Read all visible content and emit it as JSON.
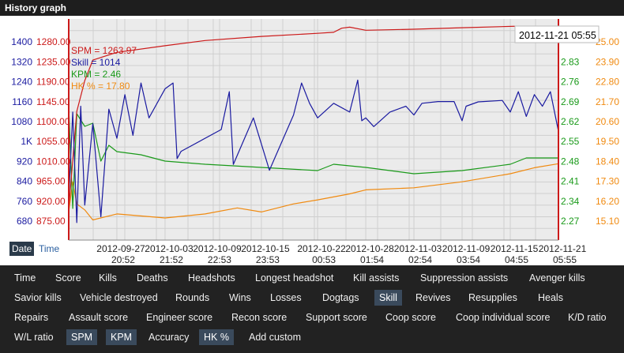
{
  "header": {
    "title": "History graph"
  },
  "tooltip": {
    "text": "2012-11-21 05:55"
  },
  "x_mode": {
    "date_label": "Date",
    "time_label": "Time",
    "selected": "Date"
  },
  "colors": {
    "skill": "#1a1aa0",
    "spm": "#cc1a1a",
    "kpm": "#1a9a1a",
    "hk": "#f08a10",
    "background": "#ebebeb",
    "grid": "#cfcfcf",
    "panel": "#222222",
    "selected": "#3a4a5c"
  },
  "chart_data": {
    "type": "line",
    "x_ticks": [
      {
        "date": "2012-09-27",
        "time": "20:52"
      },
      {
        "date": "2012-10-03",
        "time": "21:52"
      },
      {
        "date": "2012-10-09",
        "time": "22:53"
      },
      {
        "date": "2012-10-15",
        "time": "23:53"
      },
      {
        "date": "2012-10-22",
        "time": "00:53"
      },
      {
        "date": "2012-10-28",
        "time": "01:54"
      },
      {
        "date": "2012-11-03",
        "time": "02:54"
      },
      {
        "date": "2012-11-09",
        "time": "03:54"
      },
      {
        "date": "2012-11-15",
        "time": "04:55"
      },
      {
        "date": "2012-11-21",
        "time": "05:55"
      }
    ],
    "x_range": [
      "2012-09-21",
      "2012-11-21"
    ],
    "grid": true,
    "axes": [
      {
        "series": "Skill",
        "side": "left",
        "ticks": [
          "680",
          "760",
          "840",
          "920",
          "1K",
          "1080",
          "1160",
          "1240",
          "1320",
          "1400"
        ],
        "range": [
          640,
          1400
        ]
      },
      {
        "series": "SPM",
        "side": "left",
        "ticks": [
          "875.00",
          "920.00",
          "965.00",
          "1010.00",
          "1055.00",
          "1100.00",
          "1145.00",
          "1190.00",
          "1235.00",
          "1280.00"
        ],
        "range": [
          850,
          1280
        ]
      },
      {
        "series": "KPM",
        "side": "right",
        "ticks": [
          "2.27",
          "2.34",
          "2.41",
          "2.48",
          "2.55",
          "2.62",
          "2.69",
          "2.76",
          "2.83"
        ],
        "range": [
          2.2,
          2.9
        ]
      },
      {
        "series": "HK %",
        "side": "right",
        "ticks": [
          "15.10",
          "16.20",
          "17.30",
          "18.40",
          "19.50",
          "20.60",
          "21.70",
          "22.80",
          "23.90",
          "25.00"
        ],
        "range": [
          14.0,
          25.0
        ]
      }
    ],
    "legend": [
      {
        "label": "SPM = 1263.97"
      },
      {
        "label": "Skill = 1014"
      },
      {
        "label": "KPM = 2.46"
      },
      {
        "label": "HK % = 17.80"
      }
    ],
    "series": [
      {
        "name": "SPM",
        "axis": 1,
        "values": [
          [
            "2012-09-21",
            910
          ],
          [
            "2012-09-22",
            1100
          ],
          [
            "2012-09-23",
            1160
          ],
          [
            "2012-09-24",
            1200
          ],
          [
            "2012-09-27",
            1215
          ],
          [
            "2012-10-03",
            1228
          ],
          [
            "2012-10-08",
            1238
          ],
          [
            "2012-10-15",
            1246
          ],
          [
            "2012-10-22",
            1252
          ],
          [
            "2012-10-24",
            1254
          ],
          [
            "2012-10-25",
            1262
          ],
          [
            "2012-10-26",
            1264
          ],
          [
            "2012-10-28",
            1258
          ],
          [
            "2012-11-03",
            1260
          ],
          [
            "2012-11-09",
            1263
          ],
          [
            "2012-11-16",
            1266
          ],
          [
            "2012-11-17",
            1262
          ],
          [
            "2012-11-21",
            1264
          ]
        ]
      },
      {
        "name": "Skill",
        "axis": 0,
        "values": [
          [
            "2012-09-21",
            780
          ],
          [
            "2012-09-21 12:00",
            1080
          ],
          [
            "2012-09-22",
            700
          ],
          [
            "2012-09-22 12:00",
            1100
          ],
          [
            "2012-09-23",
            760
          ],
          [
            "2012-09-24",
            1040
          ],
          [
            "2012-09-25",
            720
          ],
          [
            "2012-09-26",
            1090
          ],
          [
            "2012-09-27",
            990
          ],
          [
            "2012-09-28",
            1140
          ],
          [
            "2012-09-29",
            1000
          ],
          [
            "2012-09-30",
            1180
          ],
          [
            "2012-10-01",
            1060
          ],
          [
            "2012-10-03",
            1160
          ],
          [
            "2012-10-04",
            1180
          ],
          [
            "2012-10-04 12:00",
            920
          ],
          [
            "2012-10-05",
            945
          ],
          [
            "2012-10-10",
            1020
          ],
          [
            "2012-10-11",
            1150
          ],
          [
            "2012-10-11 12:00",
            900
          ],
          [
            "2012-10-14",
            1060
          ],
          [
            "2012-10-16",
            880
          ],
          [
            "2012-10-19",
            1070
          ],
          [
            "2012-10-20",
            1180
          ],
          [
            "2012-10-21",
            1110
          ],
          [
            "2012-10-22",
            1060
          ],
          [
            "2012-10-24",
            1110
          ],
          [
            "2012-10-26",
            1080
          ],
          [
            "2012-10-27",
            1190
          ],
          [
            "2012-10-27 12:00",
            1050
          ],
          [
            "2012-10-28",
            1060
          ],
          [
            "2012-10-29",
            1030
          ],
          [
            "2012-10-31",
            1080
          ],
          [
            "2012-11-02",
            1100
          ],
          [
            "2012-11-03",
            1070
          ],
          [
            "2012-11-04",
            1110
          ],
          [
            "2012-11-06",
            1116
          ],
          [
            "2012-11-08",
            1116
          ],
          [
            "2012-11-09",
            1050
          ],
          [
            "2012-11-09 12:00",
            1100
          ],
          [
            "2012-11-11",
            1115
          ],
          [
            "2012-11-14",
            1120
          ],
          [
            "2012-11-15",
            1080
          ],
          [
            "2012-11-16",
            1150
          ],
          [
            "2012-11-17",
            1065
          ],
          [
            "2012-11-18",
            1140
          ],
          [
            "2012-11-19",
            1100
          ],
          [
            "2012-11-20",
            1150
          ],
          [
            "2012-11-21",
            1014
          ]
        ]
      },
      {
        "name": "KPM",
        "axis": 2,
        "values": [
          [
            "2012-09-21",
            2.62
          ],
          [
            "2012-09-21 12:00",
            2.3
          ],
          [
            "2012-09-22",
            2.6
          ],
          [
            "2012-09-23",
            2.56
          ],
          [
            "2012-09-24",
            2.57
          ],
          [
            "2012-09-25",
            2.45
          ],
          [
            "2012-09-26",
            2.5
          ],
          [
            "2012-09-27",
            2.48
          ],
          [
            "2012-09-30",
            2.47
          ],
          [
            "2012-10-03",
            2.45
          ],
          [
            "2012-10-08",
            2.44
          ],
          [
            "2012-10-15",
            2.43
          ],
          [
            "2012-10-22",
            2.42
          ],
          [
            "2012-10-24",
            2.44
          ],
          [
            "2012-10-28",
            2.43
          ],
          [
            "2012-11-03",
            2.41
          ],
          [
            "2012-11-09",
            2.42
          ],
          [
            "2012-11-15",
            2.44
          ],
          [
            "2012-11-17",
            2.46
          ],
          [
            "2012-11-21",
            2.46
          ]
        ]
      },
      {
        "name": "HK %",
        "axis": 3,
        "values": [
          [
            "2012-09-21",
            15.4
          ],
          [
            "2012-09-21 12:00",
            16.9
          ],
          [
            "2012-09-22",
            15.8
          ],
          [
            "2012-09-23",
            15.5
          ],
          [
            "2012-09-24",
            15.0
          ],
          [
            "2012-09-27",
            15.3
          ],
          [
            "2012-10-03",
            15.1
          ],
          [
            "2012-10-08",
            15.3
          ],
          [
            "2012-10-12",
            15.6
          ],
          [
            "2012-10-15",
            15.4
          ],
          [
            "2012-10-19",
            15.8
          ],
          [
            "2012-10-22",
            16.0
          ],
          [
            "2012-10-26",
            16.3
          ],
          [
            "2012-10-28",
            16.5
          ],
          [
            "2012-11-03",
            16.6
          ],
          [
            "2012-11-09",
            16.9
          ],
          [
            "2012-11-15",
            17.3
          ],
          [
            "2012-11-18",
            17.6
          ],
          [
            "2012-11-21",
            17.8
          ]
        ]
      }
    ]
  },
  "options": {
    "rows": [
      [
        {
          "label": "Time",
          "selected": false
        },
        {
          "label": "Score",
          "selected": false
        },
        {
          "label": "Kills",
          "selected": false
        },
        {
          "label": "Deaths",
          "selected": false
        },
        {
          "label": "Headshots",
          "selected": false
        },
        {
          "label": "Longest headshot",
          "selected": false
        },
        {
          "label": "Kill assists",
          "selected": false
        },
        {
          "label": "Suppression assists",
          "selected": false
        },
        {
          "label": "Avenger kills",
          "selected": false
        }
      ],
      [
        {
          "label": "Savior kills",
          "selected": false
        },
        {
          "label": "Vehicle destroyed",
          "selected": false
        },
        {
          "label": "Rounds",
          "selected": false
        },
        {
          "label": "Wins",
          "selected": false
        },
        {
          "label": "Losses",
          "selected": false
        },
        {
          "label": "Dogtags",
          "selected": false
        },
        {
          "label": "Skill",
          "selected": true
        },
        {
          "label": "Revives",
          "selected": false
        },
        {
          "label": "Resupplies",
          "selected": false
        },
        {
          "label": "Heals",
          "selected": false
        }
      ],
      [
        {
          "label": "Repairs",
          "selected": false
        },
        {
          "label": "Assault score",
          "selected": false
        },
        {
          "label": "Engineer score",
          "selected": false
        },
        {
          "label": "Recon score",
          "selected": false
        },
        {
          "label": "Support score",
          "selected": false
        },
        {
          "label": "Coop score",
          "selected": false
        },
        {
          "label": "Coop individual score",
          "selected": false
        },
        {
          "label": "K/D ratio",
          "selected": false
        }
      ],
      [
        {
          "label": "W/L ratio",
          "selected": false
        },
        {
          "label": "SPM",
          "selected": true
        },
        {
          "label": "KPM",
          "selected": true
        },
        {
          "label": "Accuracy",
          "selected": false
        },
        {
          "label": "HK %",
          "selected": true
        },
        {
          "label": "Add custom",
          "selected": false
        }
      ]
    ]
  }
}
